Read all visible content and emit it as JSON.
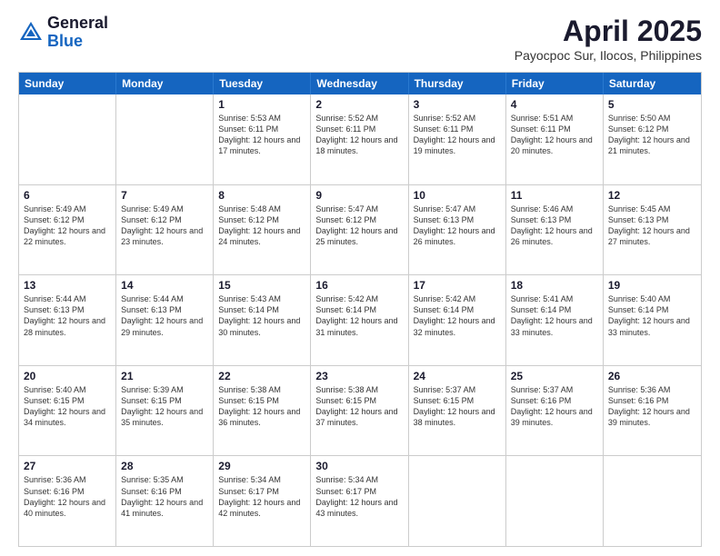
{
  "logo": {
    "general": "General",
    "blue": "Blue"
  },
  "title": "April 2025",
  "location": "Payocpoc Sur, Ilocos, Philippines",
  "days": [
    "Sunday",
    "Monday",
    "Tuesday",
    "Wednesday",
    "Thursday",
    "Friday",
    "Saturday"
  ],
  "weeks": [
    [
      {
        "day": "",
        "text": ""
      },
      {
        "day": "",
        "text": ""
      },
      {
        "day": "1",
        "text": "Sunrise: 5:53 AM\nSunset: 6:11 PM\nDaylight: 12 hours and 17 minutes."
      },
      {
        "day": "2",
        "text": "Sunrise: 5:52 AM\nSunset: 6:11 PM\nDaylight: 12 hours and 18 minutes."
      },
      {
        "day": "3",
        "text": "Sunrise: 5:52 AM\nSunset: 6:11 PM\nDaylight: 12 hours and 19 minutes."
      },
      {
        "day": "4",
        "text": "Sunrise: 5:51 AM\nSunset: 6:11 PM\nDaylight: 12 hours and 20 minutes."
      },
      {
        "day": "5",
        "text": "Sunrise: 5:50 AM\nSunset: 6:12 PM\nDaylight: 12 hours and 21 minutes."
      }
    ],
    [
      {
        "day": "6",
        "text": "Sunrise: 5:49 AM\nSunset: 6:12 PM\nDaylight: 12 hours and 22 minutes."
      },
      {
        "day": "7",
        "text": "Sunrise: 5:49 AM\nSunset: 6:12 PM\nDaylight: 12 hours and 23 minutes."
      },
      {
        "day": "8",
        "text": "Sunrise: 5:48 AM\nSunset: 6:12 PM\nDaylight: 12 hours and 24 minutes."
      },
      {
        "day": "9",
        "text": "Sunrise: 5:47 AM\nSunset: 6:12 PM\nDaylight: 12 hours and 25 minutes."
      },
      {
        "day": "10",
        "text": "Sunrise: 5:47 AM\nSunset: 6:13 PM\nDaylight: 12 hours and 26 minutes."
      },
      {
        "day": "11",
        "text": "Sunrise: 5:46 AM\nSunset: 6:13 PM\nDaylight: 12 hours and 26 minutes."
      },
      {
        "day": "12",
        "text": "Sunrise: 5:45 AM\nSunset: 6:13 PM\nDaylight: 12 hours and 27 minutes."
      }
    ],
    [
      {
        "day": "13",
        "text": "Sunrise: 5:44 AM\nSunset: 6:13 PM\nDaylight: 12 hours and 28 minutes."
      },
      {
        "day": "14",
        "text": "Sunrise: 5:44 AM\nSunset: 6:13 PM\nDaylight: 12 hours and 29 minutes."
      },
      {
        "day": "15",
        "text": "Sunrise: 5:43 AM\nSunset: 6:14 PM\nDaylight: 12 hours and 30 minutes."
      },
      {
        "day": "16",
        "text": "Sunrise: 5:42 AM\nSunset: 6:14 PM\nDaylight: 12 hours and 31 minutes."
      },
      {
        "day": "17",
        "text": "Sunrise: 5:42 AM\nSunset: 6:14 PM\nDaylight: 12 hours and 32 minutes."
      },
      {
        "day": "18",
        "text": "Sunrise: 5:41 AM\nSunset: 6:14 PM\nDaylight: 12 hours and 33 minutes."
      },
      {
        "day": "19",
        "text": "Sunrise: 5:40 AM\nSunset: 6:14 PM\nDaylight: 12 hours and 33 minutes."
      }
    ],
    [
      {
        "day": "20",
        "text": "Sunrise: 5:40 AM\nSunset: 6:15 PM\nDaylight: 12 hours and 34 minutes."
      },
      {
        "day": "21",
        "text": "Sunrise: 5:39 AM\nSunset: 6:15 PM\nDaylight: 12 hours and 35 minutes."
      },
      {
        "day": "22",
        "text": "Sunrise: 5:38 AM\nSunset: 6:15 PM\nDaylight: 12 hours and 36 minutes."
      },
      {
        "day": "23",
        "text": "Sunrise: 5:38 AM\nSunset: 6:15 PM\nDaylight: 12 hours and 37 minutes."
      },
      {
        "day": "24",
        "text": "Sunrise: 5:37 AM\nSunset: 6:15 PM\nDaylight: 12 hours and 38 minutes."
      },
      {
        "day": "25",
        "text": "Sunrise: 5:37 AM\nSunset: 6:16 PM\nDaylight: 12 hours and 39 minutes."
      },
      {
        "day": "26",
        "text": "Sunrise: 5:36 AM\nSunset: 6:16 PM\nDaylight: 12 hours and 39 minutes."
      }
    ],
    [
      {
        "day": "27",
        "text": "Sunrise: 5:36 AM\nSunset: 6:16 PM\nDaylight: 12 hours and 40 minutes."
      },
      {
        "day": "28",
        "text": "Sunrise: 5:35 AM\nSunset: 6:16 PM\nDaylight: 12 hours and 41 minutes."
      },
      {
        "day": "29",
        "text": "Sunrise: 5:34 AM\nSunset: 6:17 PM\nDaylight: 12 hours and 42 minutes."
      },
      {
        "day": "30",
        "text": "Sunrise: 5:34 AM\nSunset: 6:17 PM\nDaylight: 12 hours and 43 minutes."
      },
      {
        "day": "",
        "text": ""
      },
      {
        "day": "",
        "text": ""
      },
      {
        "day": "",
        "text": ""
      }
    ]
  ]
}
